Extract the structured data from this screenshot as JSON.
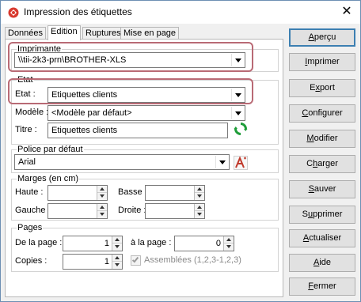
{
  "window": {
    "title": "Impression des étiquettes",
    "close_glyph": "✕"
  },
  "tabs": [
    {
      "label": "Données",
      "active": false
    },
    {
      "label": "Edition",
      "active": true
    },
    {
      "label": "Ruptures",
      "active": false
    },
    {
      "label": "Mise en page",
      "active": false
    }
  ],
  "printer": {
    "group_label": "Imprimante",
    "selected": "\\\\tii-2k3-prn\\BROTHER-XLS"
  },
  "etat": {
    "group_label": "Etat",
    "etat_label": "Etat :",
    "etat_value": "Etiquettes clients",
    "modele_label": "Modèle :",
    "modele_value": "<Modèle par défaut>",
    "titre_label": "Titre :",
    "titre_value": "Etiquettes clients"
  },
  "font": {
    "group_label": "Police par défaut",
    "value": "Arial"
  },
  "margins": {
    "group_label": "Marges (en cm)",
    "haute_label": "Haute :",
    "haute_value": "",
    "basse_label": "Basse :",
    "basse_value": "",
    "gauche_label": "Gauche :",
    "gauche_value": "",
    "droite_label": "Droite :",
    "droite_value": ""
  },
  "pages": {
    "group_label": "Pages",
    "from_label": "De la page :",
    "from_value": "1",
    "to_label": "à la page :",
    "to_value": "0",
    "copies_label": "Copies :",
    "copies_value": "1",
    "collate_label": "Assemblées (1,2,3-1,2,3)",
    "collate_checked": true
  },
  "buttons": {
    "apercu": {
      "key": "A",
      "rest": "perçu"
    },
    "imprimer": {
      "key": "I",
      "rest": "mprimer"
    },
    "export": {
      "pre": "E",
      "key": "x",
      "rest": "port"
    },
    "configurer": {
      "key": "C",
      "rest": "onfigurer"
    },
    "modifier": {
      "key": "M",
      "rest": "odifier"
    },
    "charger": {
      "pre": "C",
      "key": "h",
      "rest": "arger"
    },
    "sauver": {
      "key": "S",
      "rest": "auver"
    },
    "supprimer": {
      "pre": "S",
      "key": "u",
      "rest": "pprimer"
    },
    "actualiser": {
      "key": "A",
      "rest": "ctualiser"
    },
    "aide": {
      "key": "A",
      "rest": "ide"
    },
    "fermer": {
      "key": "F",
      "rest": "ermer"
    }
  },
  "colors": {
    "highlight": "#b96a75",
    "default_button_border": "#3c7fb1",
    "refresh_icon": "#1f9d3a",
    "font_icon": "#c0392b"
  }
}
